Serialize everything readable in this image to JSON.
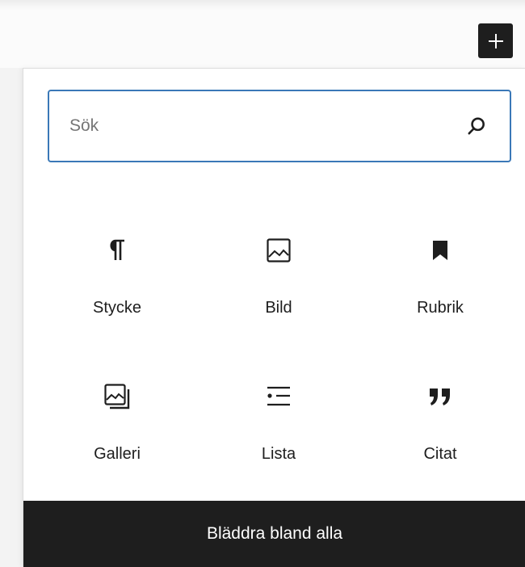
{
  "toolbar": {
    "add_icon": "plus-icon"
  },
  "inserter": {
    "search": {
      "placeholder": "Sök",
      "value": "",
      "icon": "search-icon"
    },
    "blocks": [
      {
        "label": "Stycke",
        "icon": "pilcrow-icon"
      },
      {
        "label": "Bild",
        "icon": "image-icon"
      },
      {
        "label": "Rubrik",
        "icon": "bookmark-icon"
      },
      {
        "label": "Galleri",
        "icon": "gallery-icon"
      },
      {
        "label": "Lista",
        "icon": "list-icon"
      },
      {
        "label": "Citat",
        "icon": "quote-icon"
      }
    ],
    "browse_all_label": "Bläddra bland alla"
  },
  "colors": {
    "accent": "#3a78b7",
    "dark": "#1e1e1e",
    "text": "#1e1e1e",
    "placeholder": "#757575"
  }
}
